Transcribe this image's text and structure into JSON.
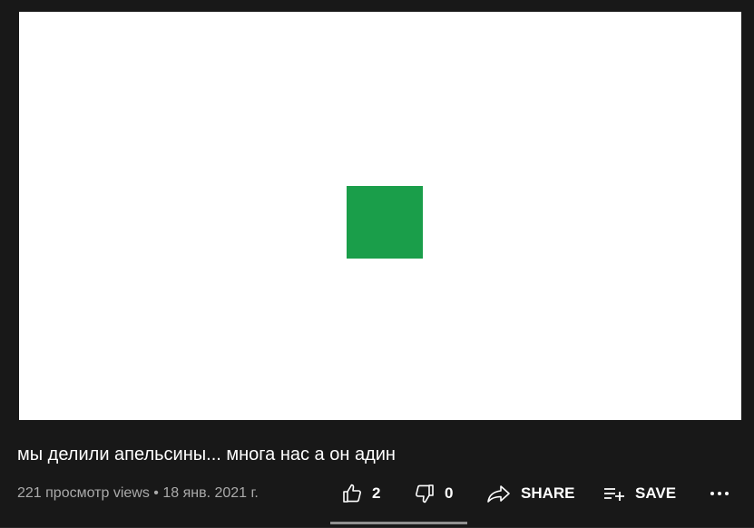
{
  "video": {
    "title": "мы делили апельсины... многа нас а он адин",
    "views_date": "221 просмотр views • 18 янв. 2021 г."
  },
  "actions": {
    "like_count": "2",
    "dislike_count": "0",
    "share_label": "SHARE",
    "save_label": "SAVE"
  },
  "icons": {
    "like": "thumbs-up-icon",
    "dislike": "thumbs-down-icon",
    "share": "share-arrow-icon",
    "save": "playlist-add-icon",
    "more": "more-horizontal-icon"
  },
  "colors": {
    "background": "#181818",
    "player": "#ffffff",
    "thumbnail_square": "#1a9e4a",
    "secondary_text": "#aaaaaa"
  }
}
